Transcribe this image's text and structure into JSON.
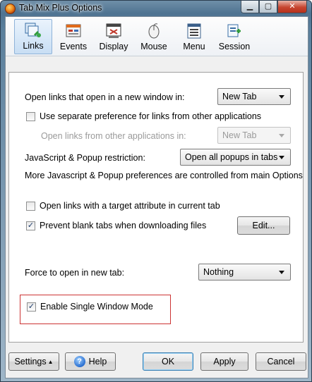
{
  "window": {
    "title": "Tab Mix Plus Options",
    "caption": {
      "minimize": "▁",
      "maximize": "▢",
      "close": "✕"
    }
  },
  "toolbar": {
    "items": [
      {
        "label": "Links",
        "icon": "links-icon",
        "selected": true
      },
      {
        "label": "Events",
        "icon": "events-icon",
        "selected": false
      },
      {
        "label": "Display",
        "icon": "display-icon",
        "selected": false
      },
      {
        "label": "Mouse",
        "icon": "mouse-icon",
        "selected": false
      },
      {
        "label": "Menu",
        "icon": "menu-icon",
        "selected": false
      },
      {
        "label": "Session",
        "icon": "session-icon",
        "selected": false
      }
    ]
  },
  "links": {
    "new_window_label": "Open links that open in a new window in:",
    "new_window_value": "New Tab",
    "separate_pref_label": "Use separate preference for links from other applications",
    "separate_pref_checked": false,
    "other_apps_label": "Open links from other applications in:",
    "other_apps_value": "New Tab",
    "popup_label": "JavaScript & Popup restriction:",
    "popup_value": "Open all popups in tabs",
    "more_prefs_text": "More Javascript & Popup preferences are controlled from main Options",
    "target_attr_label": "Open links with a target attribute in current tab",
    "target_attr_checked": false,
    "prevent_blank_label": "Prevent blank tabs when downloading files",
    "prevent_blank_checked": true,
    "edit_label": "Edit...",
    "force_label": "Force to open in new tab:",
    "force_value": "Nothing",
    "single_window_label": "Enable Single Window Mode",
    "single_window_checked": true
  },
  "footer": {
    "settings_label": "Settings",
    "help_label": "Help",
    "ok_label": "OK",
    "apply_label": "Apply",
    "cancel_label": "Cancel"
  },
  "colors": {
    "selection_border": "#8fb3d9",
    "highlight_box": "#cc3333",
    "accent": "#3c7fb1"
  }
}
